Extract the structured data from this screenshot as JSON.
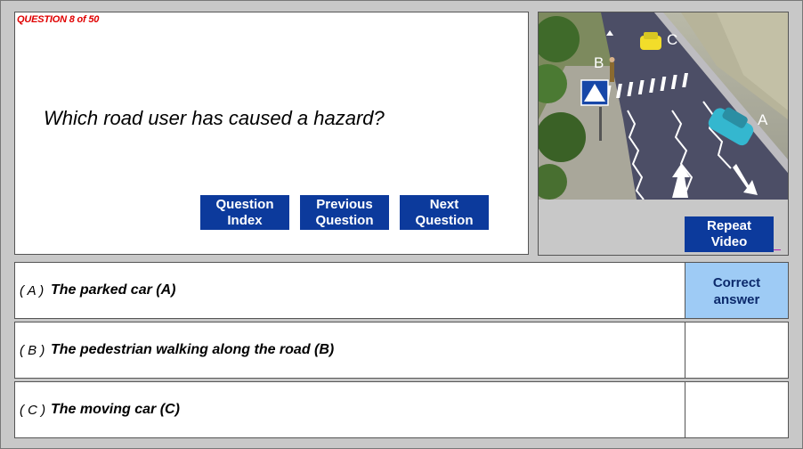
{
  "question": {
    "number_label": "QUESTION 8 of 50",
    "text": "Which road user has caused a hazard?"
  },
  "nav": {
    "index_line1": "Question",
    "index_line2": "Index",
    "prev_line1": "Previous",
    "prev_line2": "Question",
    "next_line1": "Next",
    "next_line2": "Question"
  },
  "video": {
    "replay_line1": "Repeat",
    "replay_line2": "Video",
    "scene_labels": {
      "a": "A",
      "b": "B",
      "c": "C"
    }
  },
  "answers": [
    {
      "letter": "( A )",
      "text": "The parked car (A)",
      "marker_line1": "Correct",
      "marker_line2": "answer"
    },
    {
      "letter": "( B )",
      "text": "The pedestrian walking along the road (B)"
    },
    {
      "letter": "( C )",
      "text": "The moving car (C)"
    }
  ],
  "colors": {
    "button_blue": "#0c3a9c",
    "correct_highlight": "#9ecbf5",
    "question_number_red": "#e00000"
  }
}
